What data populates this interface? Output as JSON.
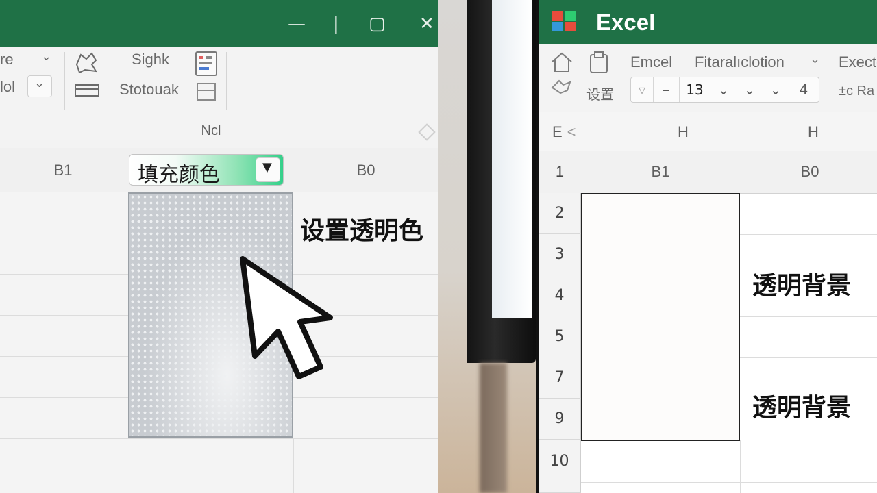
{
  "left_panel": {
    "window_controls": {
      "minimize": "—",
      "restore": "|",
      "maximize": "▢",
      "close": "✕"
    },
    "ribbon": {
      "font_name_fragment": "re",
      "font_style_fragment": "lol",
      "group1_top_label": "Sighk",
      "group1_bottom_label": "Stotouak"
    },
    "name_bar_label": "Ncl",
    "columns": [
      "B1",
      "B0"
    ],
    "fill_color_dropdown": {
      "label": "填充颜色",
      "arrow": "▼"
    },
    "callout": "设置透明色",
    "cell_fill": "transparent-pattern"
  },
  "right_panel": {
    "app_title": "Excel",
    "logo_colors": [
      "#e74c3c",
      "#2ecc71",
      "#3498db",
      "#f1c40f"
    ],
    "ribbon": {
      "font_name": "Emcel",
      "font_family_dropdown": "Fitaralıclotion",
      "right_label_top": "Execto",
      "small_label": "设置",
      "font_size": "13",
      "size_extra": "4",
      "right_label_bottom": "±c  Ra",
      "dash": "–"
    },
    "name_bar": {
      "cell_ref": "E",
      "arrow": "<",
      "col_h1": "H",
      "col_h2": "H"
    },
    "columns": [
      "B1",
      "B0"
    ],
    "rows": [
      "1",
      "2",
      "3",
      "4",
      "5",
      "7",
      "9",
      "10"
    ],
    "callouts": [
      "透明背景",
      "透明背景"
    ]
  },
  "colors": {
    "excel_green": "#1f7146",
    "accent_green": "#34d08a"
  }
}
